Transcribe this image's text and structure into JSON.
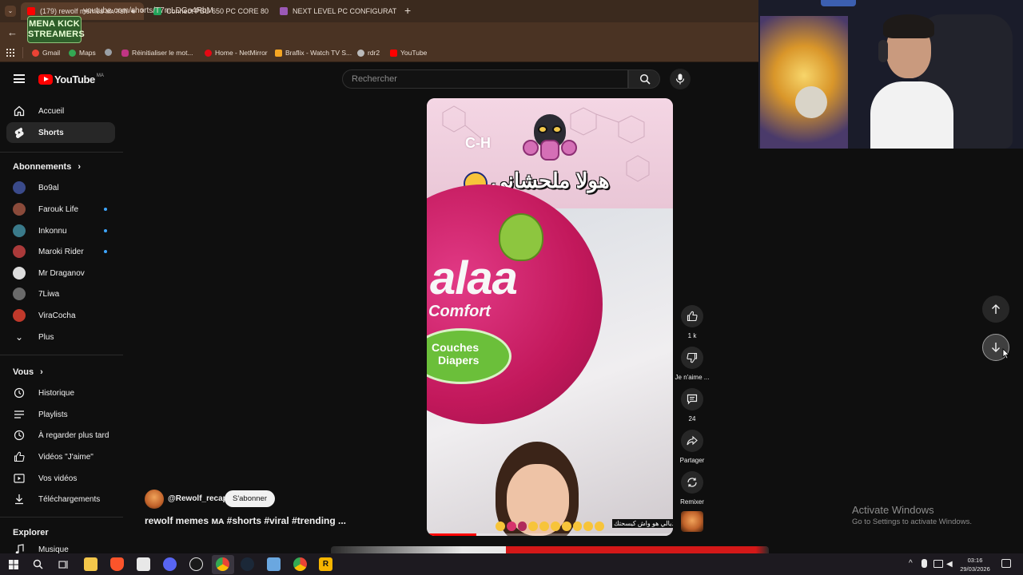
{
  "browser": {
    "tabs": [
      {
        "label": "(179) rewolf memes ᴍᴀ #sh",
        "color": "#ff0000",
        "active": true
      },
      {
        "label": "Connect PSU 650 PC CORE 80",
        "color": "#22a35a",
        "active": false
      },
      {
        "label": "NEXT LEVEL PC CONFIGURATE",
        "color": "#9b59b6",
        "active": false
      }
    ],
    "new_tab": "+",
    "url": "youtube.com/shorts/T7mLDGo4RbM",
    "bookmarks": [
      {
        "label": "Gmail",
        "color": "#ea4335"
      },
      {
        "label": "Maps",
        "color": "#34a853"
      },
      {
        "label": "",
        "color": "#9aa0a6"
      },
      {
        "label": "Réinitialiser le mot...",
        "color": "#c13584"
      },
      {
        "label": "Home - NetMirror",
        "color": "#e50914"
      },
      {
        "label": "Braflix - Watch TV S...",
        "color": "#f5a623"
      },
      {
        "label": "rdr2",
        "color": "#bbbbbb"
      },
      {
        "label": "YouTube",
        "color": "#ff0000"
      }
    ],
    "overlay_logo": "MENA KICK STREAMERS"
  },
  "header": {
    "brand": "YouTube",
    "region": "MA",
    "search_placeholder": "Rechercher"
  },
  "sidebar": {
    "main": [
      {
        "label": "Accueil",
        "icon": "home-icon"
      },
      {
        "label": "Shorts",
        "icon": "shorts-icon",
        "active": true
      }
    ],
    "subscriptions_title": "Abonnements",
    "subscriptions": [
      {
        "label": "Bo9al",
        "color": "#3a4a8a",
        "new": false
      },
      {
        "label": "Farouk Life",
        "color": "#8a4a3a",
        "new": true
      },
      {
        "label": "Inkonnu",
        "color": "#3a7a8a",
        "new": true
      },
      {
        "label": "Maroki Rider",
        "color": "#aa3a3a",
        "new": true
      },
      {
        "label": "Mr Draganov",
        "color": "#dddddd",
        "new": false
      },
      {
        "label": "7Liwa",
        "color": "#6a6a6a",
        "new": false
      },
      {
        "label": "ViraCocha",
        "color": "#c0392b",
        "new": false
      }
    ],
    "more": "Plus",
    "you_title": "Vous",
    "you": [
      {
        "label": "Historique",
        "icon": "history-icon"
      },
      {
        "label": "Playlists",
        "icon": "playlists-icon"
      },
      {
        "label": "À regarder plus tard",
        "icon": "watch-later-icon"
      },
      {
        "label": "Vidéos \"J'aime\"",
        "icon": "like-icon"
      },
      {
        "label": "Vos vidéos",
        "icon": "your-videos-icon"
      },
      {
        "label": "Téléchargements",
        "icon": "download-icon"
      }
    ],
    "explore_title": "Explorer",
    "explore": [
      {
        "label": "Musique",
        "icon": "music-icon"
      }
    ]
  },
  "short": {
    "caption_arabic": "هولا ملحشاني",
    "overlay_text_ch": "C-H",
    "brand_text": "alaa",
    "comfort_text": "Comfort",
    "couches_text": "Couches",
    "diapers_text": "Diapers",
    "subtitle_arabic": "ديالي هو واش كيسحتك",
    "channel": "@Rewolf_recap",
    "subscribe_label": "S'abonner",
    "title": "rewolf memes ᴍᴀ #shorts #viral #trending ..."
  },
  "actions": [
    {
      "label": "1 k",
      "icon": "like-icon"
    },
    {
      "label": "Je n'aime ...",
      "icon": "dislike-icon"
    },
    {
      "label": "24",
      "icon": "comment-icon"
    },
    {
      "label": "Partager",
      "icon": "share-icon"
    },
    {
      "label": "Remixer",
      "icon": "remix-icon"
    }
  ],
  "watermark": {
    "line1": "Activate Windows",
    "line2": "Go to Settings to activate Windows."
  },
  "taskbar": {
    "time": "03:16",
    "date": "29/03/2026"
  }
}
